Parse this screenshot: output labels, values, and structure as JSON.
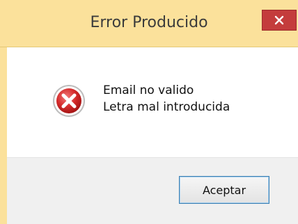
{
  "window": {
    "title": "Error Producido",
    "close_glyph": "✕"
  },
  "message": {
    "icon": "error-icon",
    "lines": [
      "Email no valido",
      "Letra mal introducida"
    ]
  },
  "buttons": {
    "accept_label": "Aceptar"
  },
  "colors": {
    "titlebar": "#fbe19b",
    "close_button": "#c43c3c",
    "error_icon": "#d42a2a",
    "footer": "#f0f0f0",
    "focus_border": "#3c7fb1"
  }
}
